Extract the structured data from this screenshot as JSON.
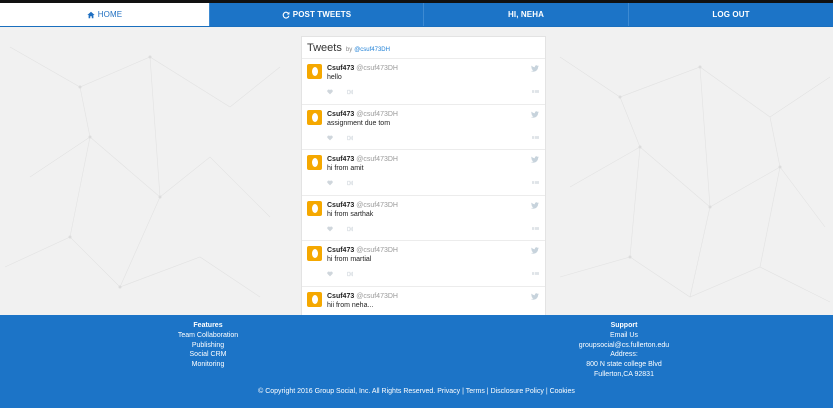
{
  "nav": {
    "home": "HOME",
    "post": "POST TWEETS",
    "greeting": "HI, NEHA",
    "logout": "LOG OUT"
  },
  "feed": {
    "title": "Tweets",
    "by": "by",
    "handle": "@csuf473DH",
    "tweets": [
      {
        "name": "Csuf473",
        "handle": "@csuf473DH",
        "text": "hello"
      },
      {
        "name": "Csuf473",
        "handle": "@csuf473DH",
        "text": "assignment due tom"
      },
      {
        "name": "Csuf473",
        "handle": "@csuf473DH",
        "text": "hi from amit"
      },
      {
        "name": "Csuf473",
        "handle": "@csuf473DH",
        "text": "hi from sarthak"
      },
      {
        "name": "Csuf473",
        "handle": "@csuf473DH",
        "text": "hi from martial"
      },
      {
        "name": "Csuf473",
        "handle": "@csuf473DH",
        "text": "hii from neha..."
      }
    ]
  },
  "footer": {
    "features": {
      "heading": "Features",
      "items": [
        "Team Collaboration",
        "Publishing",
        "Social CRM",
        "Monitoring"
      ]
    },
    "support": {
      "heading": "Support",
      "email_label": "Email Us",
      "email": "groupsocial@cs.fullerton.edu",
      "address_label": "Address:",
      "address1": "800 N state college Blvd",
      "address2": "Fullerton,CA 92831"
    },
    "copyright": "© Copyright 2016 Group Social, Inc. All Rights Reserved.",
    "links": [
      "Privacy",
      "Terms",
      "Disclosure Policy",
      "Cookies"
    ]
  },
  "colors": {
    "accent": "#1c74c7",
    "avatar": "#f5a800"
  }
}
